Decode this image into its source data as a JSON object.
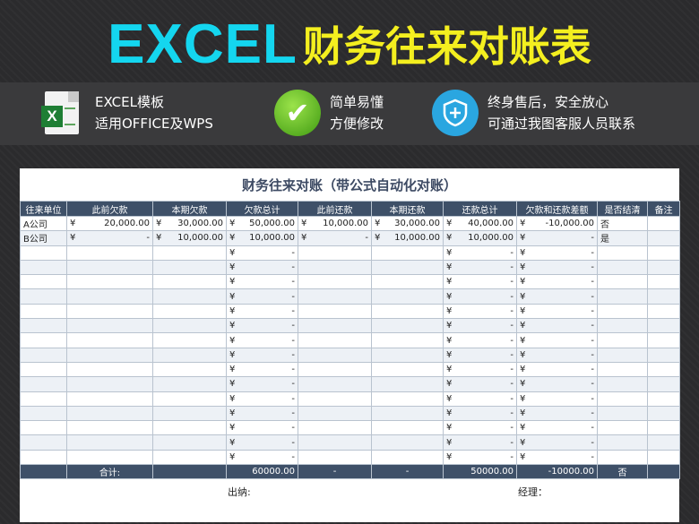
{
  "banner": {
    "title_en": "EXCEL",
    "title_cn": "财务往来对账表"
  },
  "features": [
    {
      "icon": "excel-file-icon",
      "line1": "EXCEL模板",
      "line2": "适用OFFICE及WPS"
    },
    {
      "icon": "green-check-icon",
      "line1": "简单易懂",
      "line2": "方便修改"
    },
    {
      "icon": "shield-plus-icon",
      "line1": "终身售后，安全放心",
      "line2": "可通过我图客服人员联系"
    }
  ],
  "sheet": {
    "title": "财务往来对账（带公式自动化对账）",
    "headers": [
      "往来单位",
      "此前欠款",
      "本期欠款",
      "欠款总计",
      "此前还款",
      "本期还款",
      "还款总计",
      "欠款和还款差额",
      "是否结清",
      "备注"
    ],
    "rows": [
      [
        "A公司",
        "¥|20,000.00",
        "¥|30,000.00",
        "¥|50,000.00",
        "¥|10,000.00",
        "¥|30,000.00",
        "¥|40,000.00",
        "¥|-10,000.00",
        "否",
        ""
      ],
      [
        "B公司",
        "¥|-",
        "¥|10,000.00",
        "¥|10,000.00",
        "¥|-",
        "¥|10,000.00",
        "¥|10,000.00",
        "¥|-",
        "是",
        ""
      ],
      [
        "",
        "",
        "",
        "¥|-",
        "",
        "",
        "¥|-",
        "¥|-",
        "",
        ""
      ],
      [
        "",
        "",
        "",
        "¥|-",
        "",
        "",
        "¥|-",
        "¥|-",
        "",
        ""
      ],
      [
        "",
        "",
        "",
        "¥|-",
        "",
        "",
        "¥|-",
        "¥|-",
        "",
        ""
      ],
      [
        "",
        "",
        "",
        "¥|-",
        "",
        "",
        "¥|-",
        "¥|-",
        "",
        ""
      ],
      [
        "",
        "",
        "",
        "¥|-",
        "",
        "",
        "¥|-",
        "¥|-",
        "",
        ""
      ],
      [
        "",
        "",
        "",
        "¥|-",
        "",
        "",
        "¥|-",
        "¥|-",
        "",
        ""
      ],
      [
        "",
        "",
        "",
        "¥|-",
        "",
        "",
        "¥|-",
        "¥|-",
        "",
        ""
      ],
      [
        "",
        "",
        "",
        "¥|-",
        "",
        "",
        "¥|-",
        "¥|-",
        "",
        ""
      ],
      [
        "",
        "",
        "",
        "¥|-",
        "",
        "",
        "¥|-",
        "¥|-",
        "",
        ""
      ],
      [
        "",
        "",
        "",
        "¥|-",
        "",
        "",
        "¥|-",
        "¥|-",
        "",
        ""
      ],
      [
        "",
        "",
        "",
        "¥|-",
        "",
        "",
        "¥|-",
        "¥|-",
        "",
        ""
      ],
      [
        "",
        "",
        "",
        "¥|-",
        "",
        "",
        "¥|-",
        "¥|-",
        "",
        ""
      ],
      [
        "",
        "",
        "",
        "¥|-",
        "",
        "",
        "¥|-",
        "¥|-",
        "",
        ""
      ],
      [
        "",
        "",
        "",
        "¥|-",
        "",
        "",
        "¥|-",
        "¥|-",
        "",
        ""
      ],
      [
        "",
        "",
        "",
        "¥|-",
        "",
        "",
        "¥|-",
        "¥|-",
        "",
        ""
      ]
    ],
    "sum_row": [
      "",
      "合计:",
      "",
      "60000.00",
      "-",
      "-",
      "50000.00",
      "-10000.00",
      "否",
      ""
    ],
    "footer": {
      "cashier": "出纳:",
      "manager": "经理："
    }
  }
}
